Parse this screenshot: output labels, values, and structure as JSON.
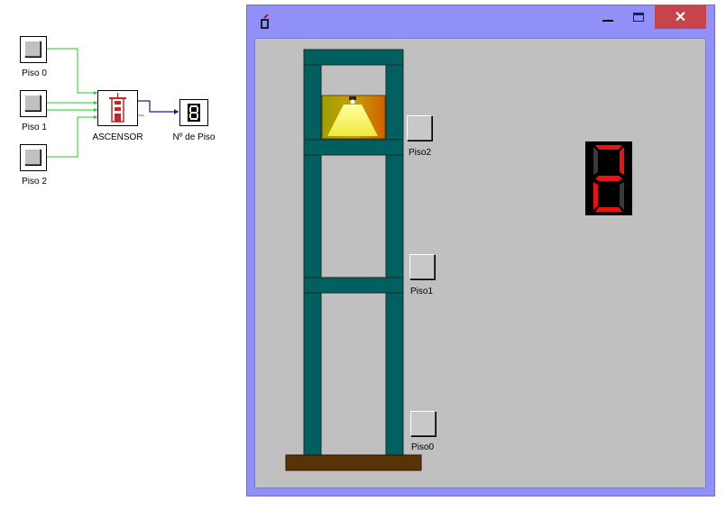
{
  "diagram": {
    "inputs": [
      {
        "label": "Piso 0"
      },
      {
        "label": "Piso 1"
      },
      {
        "label": "Piso 2"
      }
    ],
    "controller": {
      "label": "ASCENSOR"
    },
    "display": {
      "label": "Nº de Piso"
    },
    "wire_color": "#22cc22",
    "bus_color": "#1a1aa0"
  },
  "window": {
    "icon": "app-logo-icon",
    "buttons": {
      "minimize": "minimize-icon",
      "maximize": "maximize-icon",
      "close": "✕"
    },
    "titlebar_color": "#9090f8",
    "close_color": "#c7444a",
    "client_color": "#c0c0c0"
  },
  "building": {
    "frame_color": "#006060",
    "base_color": "#5a3208",
    "floors": [
      {
        "label": "Piso2"
      },
      {
        "label": "Piso1"
      },
      {
        "label": "Piso0"
      }
    ],
    "cabin_floor_index": 2
  },
  "seven_segment": {
    "value": 2,
    "on_color": "#ee1111",
    "off_color": "#3a3a3a"
  }
}
